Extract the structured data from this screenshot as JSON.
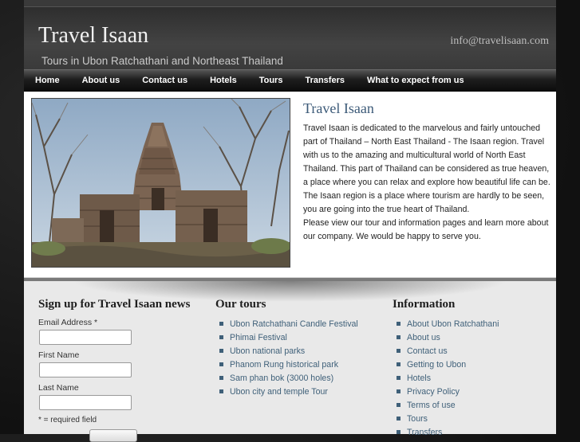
{
  "header": {
    "title": "Travel Isaan",
    "tagline": "Tours in Ubon Ratchathani and Northeast Thailand",
    "email": "info@travelisaan.com"
  },
  "nav": {
    "items": [
      "Home",
      "About us",
      "Contact us",
      "Hotels",
      "Tours",
      "Transfers",
      "What to expect from us"
    ]
  },
  "intro": {
    "title": "Travel Isaan",
    "paragraphs": [
      "Travel Isaan is dedicated to the marvelous and fairly untouched part of Thailand – North East Thailand - The Isaan region. Travel with us to the amazing and multicultural world of North East Thailand. This part of Thailand can be considered as true heaven, a place where you can relax and explore how beautiful life can be. The Isaan region is a place where tourism are hardly to be seen, you are going into the true heart of Thailand.",
      "Please view our tour and information pages and learn more about our company. We would be happy to serve you."
    ]
  },
  "signup": {
    "title": "Sign up for Travel Isaan news",
    "email_label": "Email Address *",
    "first_name_label": "First Name",
    "last_name_label": "Last Name",
    "required_note": "* = required field"
  },
  "tours": {
    "title": "Our tours",
    "items": [
      "Ubon Ratchathani Candle Festival",
      "Phimai Festival",
      "Ubon national parks",
      "Phanom Rung historical park",
      "Sam phan bok (3000 holes)",
      "Ubon city and temple Tour"
    ]
  },
  "information": {
    "title": "Information",
    "items": [
      "About Ubon Ratchathani",
      "About us",
      "Contact us",
      "Getting to Ubon",
      "Hotels",
      "Privacy Policy",
      "Terms of use",
      "Tours",
      "Transfers"
    ]
  },
  "colors": {
    "link": "#3f6079",
    "intro_title": "#3c5a78"
  }
}
